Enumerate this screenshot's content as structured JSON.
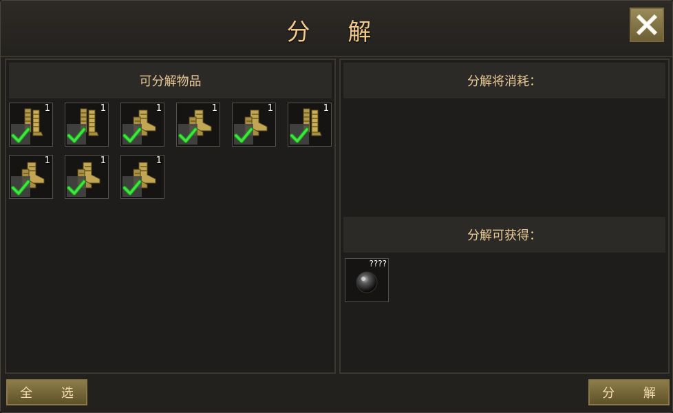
{
  "window": {
    "title": "分 解"
  },
  "left_panel": {
    "header": "可分解物品",
    "items": [
      {
        "icon": "leg-armor-icon",
        "count": "1",
        "checked": true
      },
      {
        "icon": "leg-armor-icon",
        "count": "1",
        "checked": true
      },
      {
        "icon": "boots-icon",
        "count": "1",
        "checked": true
      },
      {
        "icon": "boots-icon",
        "count": "1",
        "checked": true
      },
      {
        "icon": "boots-icon",
        "count": "1",
        "checked": true
      },
      {
        "icon": "leg-armor-icon",
        "count": "1",
        "checked": true
      },
      {
        "icon": "boots-icon",
        "count": "1",
        "checked": true
      },
      {
        "icon": "boots-icon",
        "count": "1",
        "checked": true
      },
      {
        "icon": "boots-icon",
        "count": "1",
        "checked": true
      }
    ]
  },
  "right_panel": {
    "consume_header": "分解将消耗：",
    "obtain_header": "分解可获得：",
    "result": {
      "icon": "dark-orb-icon",
      "count": "????"
    }
  },
  "buttons": {
    "select_all": "全 选",
    "decompose": "分 解"
  },
  "colors": {
    "gold_text": "#e8c896",
    "check_green": "#22cc22",
    "button_gold": "#8d7d49"
  }
}
